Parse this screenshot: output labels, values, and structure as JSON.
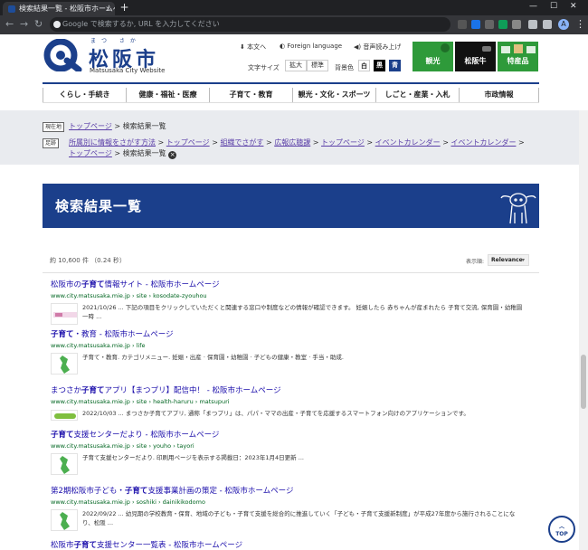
{
  "browser": {
    "tab_title": "検索結果一覧 - 松阪市ホームページ",
    "tab_close": "×",
    "new_tab": "+",
    "omnibox_placeholder": "Google で検索するか, URL を入力してください",
    "window_controls": [
      "—",
      "☐",
      "✕"
    ],
    "profile_initial": "A"
  },
  "header": {
    "logo_ruby": "まつ さか",
    "logo_name": "松阪市",
    "logo_en": "Matsusaka City Website",
    "text_version": "本文へ",
    "foreign_language": "Foreign language",
    "read_aloud": "音声読み上げ",
    "font_size_label": "文字サイズ",
    "font_size_options": [
      "拡大",
      "標準"
    ],
    "bg_color_label": "背景色",
    "bg_color_options": [
      "白",
      "黒",
      "青"
    ],
    "banners": [
      "観光",
      "松阪牛",
      "特産品"
    ]
  },
  "colors": {
    "brand_blue": "#1b3f8b",
    "banner_green": "#2e9a3a",
    "banner_dark": "#111111",
    "link": "#1a0dab",
    "url_green": "#006621"
  },
  "gnav": [
    "くらし・手続き",
    "健康・福祉・医療",
    "子育て・教育",
    "観光・文化・スポーツ",
    "しごと・産業・入札",
    "市政情報"
  ],
  "breadcrumbs": {
    "current_tag": "現在地",
    "current_links": [
      "トップページ"
    ],
    "current_text": "検索結果一覧",
    "trail_tag": "足跡",
    "trail_links": [
      "所属別に情報をさがす方法",
      "トップページ",
      "組織でさがす",
      "広報広聴課",
      "トップページ",
      "イベントカレンダー",
      "イベントカレンダー",
      "トップページ"
    ],
    "trail_current": "検索結果一覧",
    "separator": ">",
    "remove_icon": "×"
  },
  "page_title": "検索結果一覧",
  "results": {
    "count": "約 10,600 件 （0.24 秒）",
    "sort_label": "表示順:",
    "sort_value": "Relevance",
    "items": [
      {
        "title_pre": "松阪市の",
        "title_bold": "子育て",
        "title_post": "情報サイト - 松阪市ホームページ",
        "url": "www.city.matsusaka.mie.jp › site › kosodate-zyouhou",
        "snippet": "2021/10/26 ... 下記の項目をクリックしていただくと関連する窓口や制度などの情報が確認できます。 妊娠したら 赤ちゃんが産まれたら 子育て交流, 保育園・幼稚園一時 ..."
      },
      {
        "title_pre": "",
        "title_bold": "子育て",
        "title_post": "・教育 - 松阪市ホームページ",
        "url": "www.city.matsusaka.mie.jp › life",
        "snippet": "子育て・教育. カテゴリメニュー. 妊娠・出産 · 保育園・幼稚園 · 子どもの健康・教室 · 手当・助成."
      },
      {
        "title_pre": "まつさか",
        "title_bold": "子育て",
        "title_post": "アプリ【まつプリ】配信中！ - 松阪市ホームページ",
        "url": "www.city.matsusaka.mie.jp › site › health-haruru › matsupuri",
        "snippet": "2022/10/03 ... まつさか子育てアプリ, 通称「まつプリ」は、パパ・ママの出産・子育てを応援するスマートフォン向けのアプリケーションです。"
      },
      {
        "title_pre": "",
        "title_bold": "子育て",
        "title_post": "支援センターだより - 松阪市ホームページ",
        "url": "www.city.matsusaka.mie.jp › site › youho › tayori",
        "snippet": "子育て支援センターだより. 印刷用ページを表示する掲載日：2023年1月4日更新 ..."
      },
      {
        "title_pre": "第2期松阪市子ども・",
        "title_bold": "子育て",
        "title_post": "支援事業計画の策定 - 松阪市ホームページ",
        "url": "www.city.matsusaka.mie.jp › soshiki › dainikikodomo",
        "snippet": "2022/09/22 ... 幼児期の学校教育・保育、地域の子ども・子育て支援を総合的に推進していく「子ども・子育て支援新制度」が平成27年度から施行されることになり、松阪 ..."
      },
      {
        "title_pre": "松阪市",
        "title_bold": "子育て",
        "title_post": "支援センター一覧表 - 松阪市ホームページ",
        "url": "",
        "snippet": ""
      }
    ]
  },
  "top_button": {
    "arrow": "︿",
    "label": "TOP"
  }
}
